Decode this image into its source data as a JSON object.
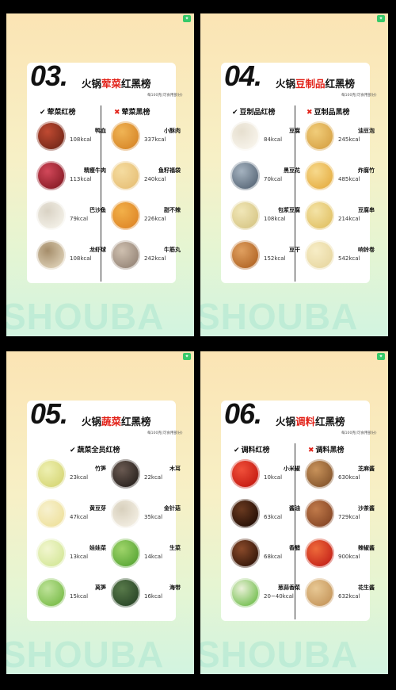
{
  "panels": [
    {
      "num": "03.",
      "title_pre": "火锅",
      "title_hl": "荤菜",
      "title_post": "红黑榜",
      "note": "每100克(可食用部分)",
      "red_label": "荤菜红榜",
      "black_label": "荤菜黑榜",
      "red": [
        {
          "name": "鸭血",
          "kcal": "108kcal",
          "icon": "duck-blood-icon"
        },
        {
          "name": "精瘦牛肉",
          "kcal": "113kcal",
          "icon": "lean-beef-icon"
        },
        {
          "name": "巴沙鱼",
          "kcal": "79kcal",
          "icon": "basa-fish-icon"
        },
        {
          "name": "龙虾球",
          "kcal": "108kcal",
          "icon": "lobster-ball-icon"
        }
      ],
      "black": [
        {
          "name": "小酥肉",
          "kcal": "337kcal",
          "icon": "crispy-pork-icon"
        },
        {
          "name": "鱼籽福袋",
          "kcal": "240kcal",
          "icon": "roe-pouch-icon"
        },
        {
          "name": "甜不辣",
          "kcal": "226kcal",
          "icon": "tempura-icon"
        },
        {
          "name": "牛筋丸",
          "kcal": "242kcal",
          "icon": "beef-ball-icon"
        }
      ]
    },
    {
      "num": "04.",
      "title_pre": "火锅",
      "title_hl": "豆制品",
      "title_post": "红黑榜",
      "note": "每100克(可食用部分)",
      "red_label": "豆制品红榜",
      "black_label": "豆制品黑榜",
      "red": [
        {
          "name": "豆腐",
          "kcal": "84kcal",
          "icon": "tofu-icon"
        },
        {
          "name": "黑豆花",
          "kcal": "70kcal",
          "icon": "black-tofu-pudding-icon"
        },
        {
          "name": "包浆豆腐",
          "kcal": "108kcal",
          "icon": "pulp-tofu-icon"
        },
        {
          "name": "豆干",
          "kcal": "152kcal",
          "icon": "dried-tofu-icon"
        }
      ],
      "black": [
        {
          "name": "油豆泡",
          "kcal": "245kcal",
          "icon": "fried-tofu-puff-icon"
        },
        {
          "name": "炸腐竹",
          "kcal": "485kcal",
          "icon": "fried-yuba-icon"
        },
        {
          "name": "豆腐串",
          "kcal": "214kcal",
          "icon": "tofu-skewer-icon"
        },
        {
          "name": "响铃卷",
          "kcal": "542kcal",
          "icon": "tofu-roll-icon"
        }
      ]
    },
    {
      "num": "05.",
      "title_pre": "火锅",
      "title_hl": "蔬菜",
      "title_post": "红黑榜",
      "note": "每100克(可食用部分)",
      "red_label": "蔬菜全员红榜",
      "black_label": "",
      "red": [
        {
          "name": "竹笋",
          "kcal": "23kcal",
          "icon": "bamboo-shoot-icon"
        },
        {
          "name": "黄豆芽",
          "kcal": "47kcal",
          "icon": "soybean-sprout-icon"
        },
        {
          "name": "娃娃菜",
          "kcal": "13kcal",
          "icon": "baby-cabbage-icon"
        },
        {
          "name": "莴笋",
          "kcal": "15kcal",
          "icon": "celtuce-icon"
        }
      ],
      "black": [
        {
          "name": "木耳",
          "kcal": "22kcal",
          "icon": "wood-ear-icon"
        },
        {
          "name": "金针菇",
          "kcal": "35kcal",
          "icon": "enoki-icon"
        },
        {
          "name": "生菜",
          "kcal": "14kcal",
          "icon": "lettuce-icon"
        },
        {
          "name": "海带",
          "kcal": "16kcal",
          "icon": "kelp-icon"
        }
      ]
    },
    {
      "num": "06.",
      "title_pre": "火锅",
      "title_hl": "调料",
      "title_post": "红黑榜",
      "note": "每100克(可食用部分)",
      "red_label": "调料红榜",
      "black_label": "调料黑榜",
      "red": [
        {
          "name": "小米椒",
          "kcal": "10kcal",
          "icon": "chili-icon"
        },
        {
          "name": "酱油",
          "kcal": "63kcal",
          "icon": "soy-sauce-icon"
        },
        {
          "name": "香醋",
          "kcal": "68kcal",
          "icon": "vinegar-icon"
        },
        {
          "name": "葱蒜香菜",
          "kcal": "20~40kcal",
          "icon": "scallion-garlic-icon"
        }
      ],
      "black": [
        {
          "name": "芝麻酱",
          "kcal": "630kcal",
          "icon": "sesame-paste-icon"
        },
        {
          "name": "沙茶酱",
          "kcal": "729kcal",
          "icon": "satay-sauce-icon"
        },
        {
          "name": "辣椒酱",
          "kcal": "900kcal",
          "icon": "chili-sauce-icon"
        },
        {
          "name": "花生酱",
          "kcal": "632kcal",
          "icon": "peanut-butter-icon"
        }
      ]
    }
  ],
  "watermark": "SHOUBA",
  "food_colors": {
    "duck-blood-icon": [
      "#7a2a1a",
      "#c04a32"
    ],
    "lean-beef-icon": [
      "#8e1f2a",
      "#d2485a"
    ],
    "basa-fish-icon": [
      "#f2efe6",
      "#d9d2c4"
    ],
    "lobster-ball-icon": [
      "#d9cbb0",
      "#a58d6a"
    ],
    "crispy-pork-icon": [
      "#d98a2b",
      "#f0b455"
    ],
    "roe-pouch-icon": [
      "#e8c27a",
      "#f5dca0"
    ],
    "tempura-icon": [
      "#e08a2a",
      "#f2b049"
    ],
    "beef-ball-icon": [
      "#9a8a7c",
      "#cfc0b0"
    ],
    "tofu-icon": [
      "#f7f3ea",
      "#e6dfcf"
    ],
    "black-tofu-pudding-icon": [
      "#5f6e7e",
      "#a5b3c0"
    ],
    "pulp-tofu-icon": [
      "#d9c98a",
      "#f1e7b8"
    ],
    "dried-tofu-icon": [
      "#b56a2a",
      "#e0a060"
    ],
    "fried-tofu-puff-icon": [
      "#d9a64a",
      "#f1cd7a"
    ],
    "fried-yuba-icon": [
      "#e7b24a",
      "#f7d98c"
    ],
    "tofu-skewer-icon": [
      "#e3c46a",
      "#f4e3a6"
    ],
    "tofu-roll-icon": [
      "#e9d9a4",
      "#f7edc6"
    ],
    "bamboo-shoot-icon": [
      "#d8d87a",
      "#eef0b2"
    ],
    "soybean-sprout-icon": [
      "#efe2a0",
      "#f7f1cf"
    ],
    "baby-cabbage-icon": [
      "#d6e89c",
      "#f2f6d0"
    ],
    "celtuce-icon": [
      "#7fbf4f",
      "#bfe39a"
    ],
    "wood-ear-icon": [
      "#2e2622",
      "#6a5a52"
    ],
    "enoki-icon": [
      "#f1ece0",
      "#d8d0bd"
    ],
    "lettuce-icon": [
      "#5faa3a",
      "#9fd46a"
    ],
    "kelp-icon": [
      "#2d4a2a",
      "#587a4a"
    ],
    "chili-icon": [
      "#c81e14",
      "#f0503a"
    ],
    "soy-sauce-icon": [
      "#2a1208",
      "#6a3a20"
    ],
    "vinegar-icon": [
      "#3a1a0c",
      "#8a4a2a"
    ],
    "scallion-garlic-icon": [
      "#7cc25a",
      "#eaf1d8"
    ],
    "sesame-paste-icon": [
      "#8a5a30",
      "#c8925a"
    ],
    "satay-sauce-icon": [
      "#8a4a28",
      "#c07a4a"
    ],
    "chili-sauce-icon": [
      "#c8281c",
      "#ee6a3a"
    ],
    "peanut-butter-icon": [
      "#c89a60",
      "#e8c894"
    ]
  }
}
